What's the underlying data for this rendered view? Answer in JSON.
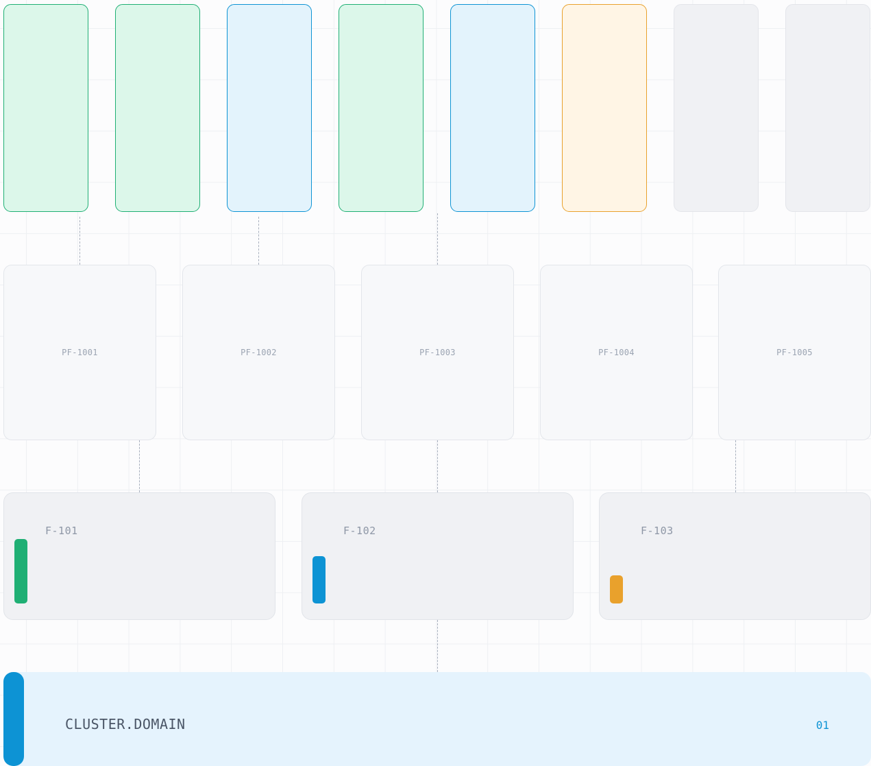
{
  "colors": {
    "healthy": "#1faf74",
    "info": "#0d93d4",
    "warning": "#e9a12c",
    "idle": "#e3e5ea"
  },
  "pods": [
    {
      "status": "green"
    },
    {
      "status": "green"
    },
    {
      "status": "blue"
    },
    {
      "status": "green"
    },
    {
      "status": "blue"
    },
    {
      "status": "amber"
    },
    {
      "status": "gray"
    },
    {
      "status": "gray"
    }
  ],
  "platform_nodes": [
    {
      "label": "PF-1001"
    },
    {
      "label": "PF-1002"
    },
    {
      "label": "PF-1003"
    },
    {
      "label": "PF-1004"
    },
    {
      "label": "PF-1005"
    }
  ],
  "fabric_nodes": [
    {
      "label": "F-101",
      "level": 0.68,
      "color": "#1faf74"
    },
    {
      "label": "F-102",
      "level": 0.5,
      "color": "#0d93d4"
    },
    {
      "label": "F-103",
      "level": 0.3,
      "color": "#e9a12c"
    }
  ],
  "cluster": {
    "label": "CLUSTER.DOMAIN",
    "index": "01"
  }
}
